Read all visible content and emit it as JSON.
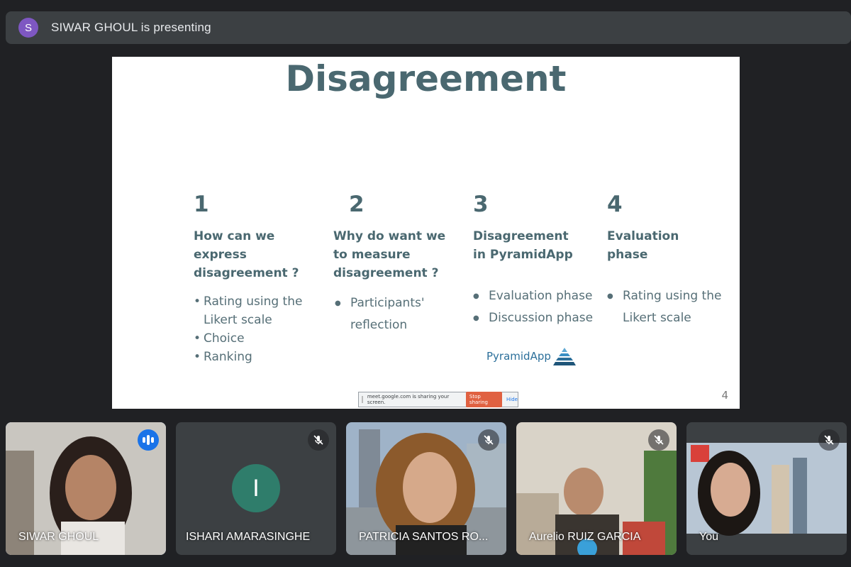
{
  "presenting": {
    "avatar_letter": "S",
    "text": "SIWAR GHOUL is presenting"
  },
  "slide": {
    "title": "Disagreement",
    "columns": [
      {
        "number": "1",
        "heading": [
          "How can we",
          "express",
          "disagreement ?"
        ],
        "bullets": [
          "Rating using the Likert scale",
          "Choice",
          "Ranking"
        ]
      },
      {
        "number": "2",
        "heading": [
          "Why do want we",
          "to measure",
          "disagreement ?"
        ],
        "bullets": [
          "Participants' reflection"
        ]
      },
      {
        "number": "3",
        "heading": [
          "Disagreement",
          "in PyramidApp"
        ],
        "bullets": [
          "Evaluation phase",
          "Discussion phase"
        ]
      },
      {
        "number": "4",
        "heading": [
          "Evaluation",
          "phase"
        ],
        "bullets": [
          "Rating using the Likert scale"
        ]
      }
    ],
    "logo_text": "PyramidApp",
    "page_number": "4",
    "share_bar": {
      "message": "meet.google.com is sharing your screen.",
      "stop_label": "Stop sharing",
      "hide_label": "Hide"
    }
  },
  "participants": [
    {
      "name": "SIWAR GHOUL",
      "state": "speaking"
    },
    {
      "name": "ISHARI AMARASINGHE",
      "state": "muted",
      "initial": "I"
    },
    {
      "name": "PATRICIA SANTOS RO...",
      "state": "muted"
    },
    {
      "name": "Aurelio RUIZ GARCIA",
      "state": "muted"
    },
    {
      "name": "You",
      "state": "muted"
    }
  ],
  "colors": {
    "background": "#202124",
    "tile": "#3c4043",
    "accent": "#8ab4f8",
    "speaking": "#1a73e8",
    "slide_text": "#4a6870",
    "initial_avatar": "#2f7d6b"
  }
}
